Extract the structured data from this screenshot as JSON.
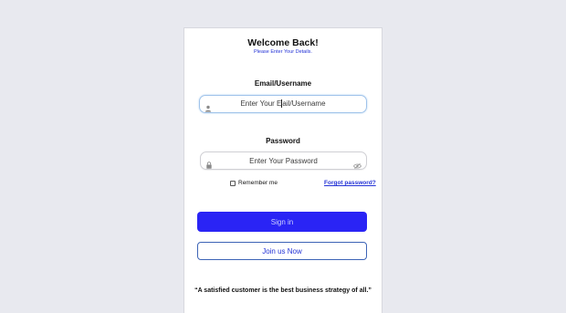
{
  "login": {
    "title": "Welcome Back!",
    "subtitle": "Please Enter Your Details.",
    "email_label": "Email/Username",
    "email_placeholder_before": "Enter Your E",
    "email_placeholder_after": "ail/Username",
    "password_label": "Password",
    "password_placeholder": "Enter Your Password",
    "remember_label": "Remember me",
    "remember_checked": false,
    "forgot_link": "Forgot password?",
    "signin_button": "Sign in",
    "join_button": "Join us Now",
    "quote": "“A satisfied customer is the best business strategy of all.”"
  },
  "icons": {
    "email_field_icon": "user-icon",
    "password_field_icon": "lock-icon",
    "password_toggle_icon": "eye-slash-icon"
  },
  "colors": {
    "background": "#e8e9ef",
    "accent": "#2433d6",
    "signin_bg": "#2a24f5",
    "input_focus_border": "#9fc3ea"
  }
}
